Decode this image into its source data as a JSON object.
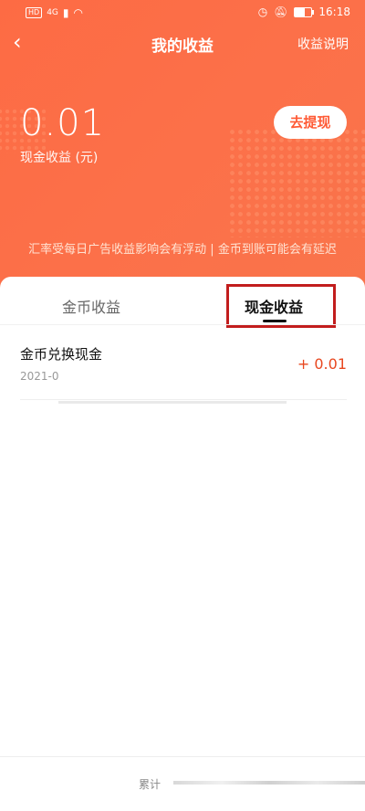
{
  "status_bar": {
    "network_badge": "HD",
    "signal_badge": "4G",
    "time": "16:18"
  },
  "header": {
    "back_icon": "chevron-left-icon",
    "title": "我的收益",
    "explain_link": "收益说明"
  },
  "balance": {
    "amount": "0.01",
    "label": "现金收益 (元)",
    "withdraw_button": "去提现"
  },
  "notice": "汇率受每日广告收益影响会有浮动 | 金币到账可能会有延迟",
  "tabs": [
    {
      "label": "金币收益",
      "active": false
    },
    {
      "label": "现金收益",
      "active": true
    }
  ],
  "records": [
    {
      "title": "金币兑换现金",
      "date": "2021-0",
      "amount": "+ 0.01"
    }
  ],
  "footer": {
    "text": "累计"
  },
  "colors": {
    "header_orange": "#fd6b44",
    "amount_red": "#e8471f",
    "highlight_box": "#c21d1d"
  }
}
